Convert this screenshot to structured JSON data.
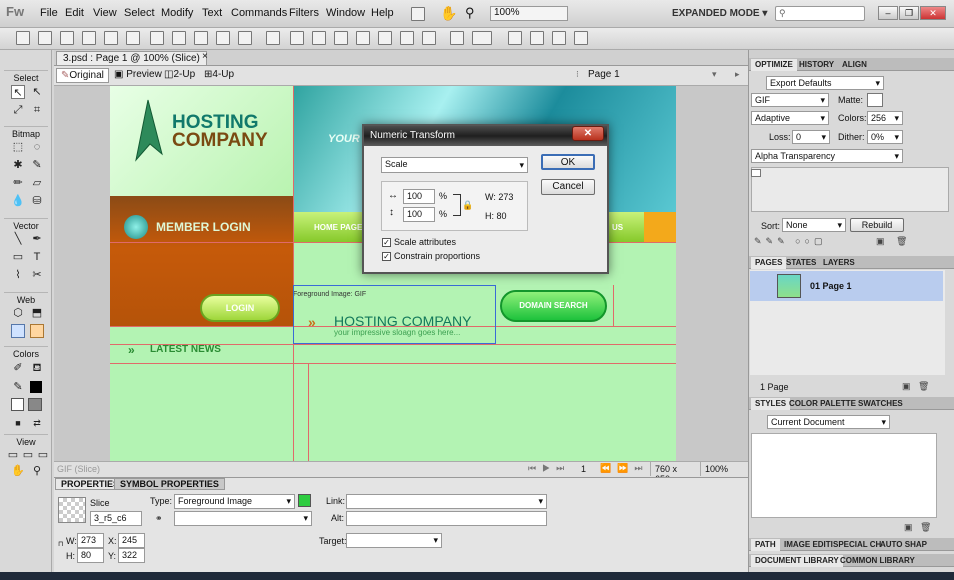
{
  "app": {
    "logo": "Fw",
    "menus": [
      "File",
      "Edit",
      "View",
      "Select",
      "Modify",
      "Text",
      "Commands",
      "Filters",
      "Window",
      "Help"
    ],
    "zoom": "100%",
    "mode": "EXPANDED MODE"
  },
  "document": {
    "tab_title": "3.psd : Page 1 @ 100% (Slice)",
    "views": [
      "Original",
      "Preview",
      "2-Up",
      "4-Up"
    ],
    "page_label": "Page 1"
  },
  "tools": {
    "sections": [
      "Select",
      "Bitmap",
      "Vector",
      "Web",
      "Colors",
      "View"
    ]
  },
  "canvas": {
    "brand_line1": "HOSTING",
    "brand_line2": "COMPANY",
    "your": "YOUR",
    "member_login": "MEMBER LOGIN",
    "home_page": "HOME PAGE",
    "us": "US",
    "login": "LOGIN",
    "domain_search": "DOMAIN SEARCH",
    "latest_news": "LATEST NEWS",
    "slice_label": "Foreground Image: GIF",
    "hosting_company": "HOSTING COMPANY",
    "slogan": "your impressive sloagn goes here..."
  },
  "status": {
    "left": "GIF (Slice)",
    "page": "1",
    "size": "760 x 650",
    "zoom": "100%"
  },
  "properties": {
    "tabs": [
      "PROPERTIES",
      "SYMBOL PROPERTIES"
    ],
    "kind": "Slice",
    "name": "3_r5_c6",
    "type_label": "Type:",
    "type_value": "Foreground Image",
    "link_label": "Link:",
    "alt_label": "Alt:",
    "target_label": "Target:",
    "w_label": "W:",
    "w": "273",
    "x_label": "X:",
    "x": "245",
    "h_label": "H:",
    "h": "80",
    "y_label": "Y:",
    "y": "322"
  },
  "optimize": {
    "tabs": [
      "OPTIMIZE",
      "HISTORY",
      "ALIGN"
    ],
    "preset": "Export Defaults",
    "format": "GIF",
    "matte_label": "Matte:",
    "palette": "Adaptive",
    "colors_label": "Colors:",
    "colors": "256",
    "loss_label": "Loss:",
    "loss": "0",
    "dither_label": "Dither:",
    "dither": "0%",
    "transparency": "Alpha Transparency",
    "sort_label": "Sort:",
    "sort": "None",
    "rebuild": "Rebuild"
  },
  "pages": {
    "tabs": [
      "PAGES",
      "STATES",
      "LAYERS"
    ],
    "item": "01  Page 1",
    "count": "1 Page"
  },
  "styles": {
    "tabs": [
      "STYLES",
      "COLOR PALETTE",
      "SWATCHES"
    ],
    "scope": "Current Document"
  },
  "bottom_tabs": [
    "PATH",
    "IMAGE EDITI",
    "SPECIAL CH",
    "AUTO SHAP"
  ],
  "doc_library": [
    "DOCUMENT LIBRARY",
    "COMMON LIBRARY"
  ],
  "dialog": {
    "title": "Numeric Transform",
    "mode": "Scale",
    "ok": "OK",
    "cancel": "Cancel",
    "width_pct": "100",
    "height_pct": "100",
    "pct": "%",
    "w_readout": "W: 273",
    "h_readout": "H: 80",
    "scale_attributes": "Scale attributes",
    "constrain": "Constrain proportions"
  },
  "colors": {
    "accent_green": "#2ecc40",
    "canvas_green": "#b3f3b3",
    "brand_teal": "#11796b",
    "brand_brown": "#7a4a12"
  }
}
